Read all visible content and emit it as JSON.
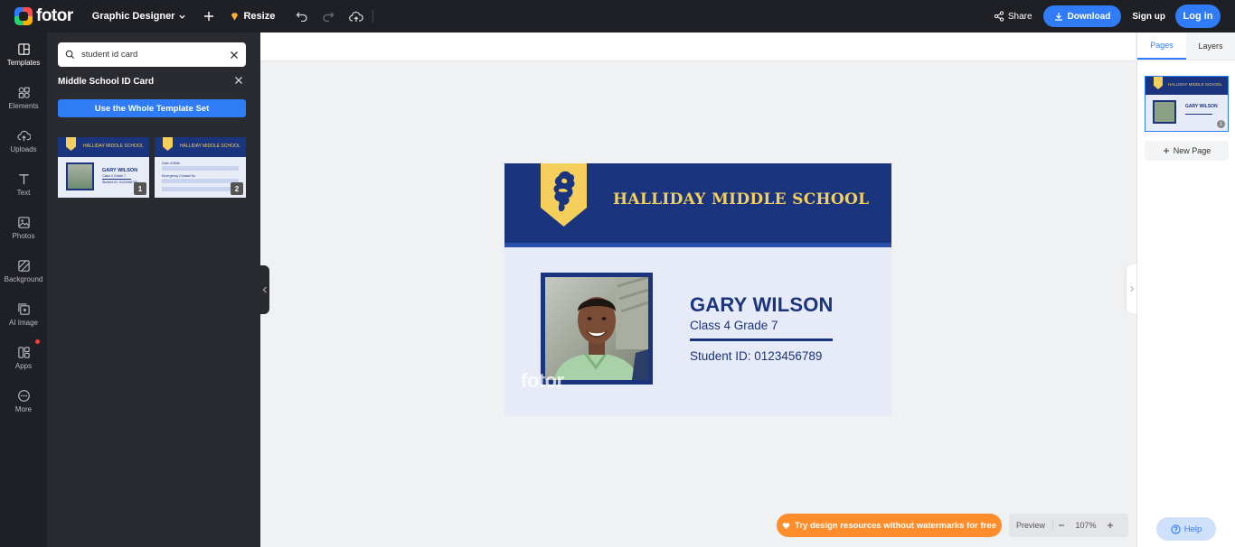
{
  "header": {
    "brand": "fotor",
    "design_type": "Graphic Designer",
    "resize_label": "Resize",
    "share_label": "Share",
    "download_label": "Download",
    "signup_label": "Sign up",
    "login_label": "Log in"
  },
  "sidebar": {
    "items": [
      {
        "label": "Templates",
        "icon": "templates-icon"
      },
      {
        "label": "Elements",
        "icon": "elements-icon"
      },
      {
        "label": "Uploads",
        "icon": "upload-cloud-icon"
      },
      {
        "label": "Text",
        "icon": "text-icon"
      },
      {
        "label": "Photos",
        "icon": "photo-icon"
      },
      {
        "label": "Background",
        "icon": "background-icon"
      },
      {
        "label": "AI Image",
        "icon": "ai-image-icon"
      },
      {
        "label": "Apps",
        "icon": "apps-icon"
      },
      {
        "label": "More",
        "icon": "more-icon"
      }
    ]
  },
  "panel": {
    "search_value": "student id card",
    "title": "Middle School ID Card",
    "use_button": "Use the Whole Template Set",
    "thumbs": [
      {
        "number": "1",
        "school": "HALLIDAY MIDDLE SCHOOL",
        "name": "GARY WILSON",
        "line": "Class 4 Grade 7",
        "sid": "Student ID: 0123456789"
      },
      {
        "number": "2",
        "school": "HALLIDAY MIDDLE SCHOOL",
        "field1": "Date of Birth",
        "field2": "Emergency Contact No."
      }
    ]
  },
  "card": {
    "school": "HALLIDAY MIDDLE SCHOOL",
    "name": "GARY WILSON",
    "class_line": "Class 4 Grade 7",
    "student_id": "Student ID: 0123456789",
    "watermark": "fotor",
    "colors": {
      "navy": "#1a347e",
      "gold": "#f5cf5c",
      "light": "#e6ebf7"
    }
  },
  "bottom": {
    "promo": "Try design resources without watermarks for free",
    "preview": "Preview",
    "zoom": "107%"
  },
  "right_panel": {
    "tab_pages": "Pages",
    "tab_layers": "Layers",
    "page_number": "1",
    "thumb_school": "HALLIDAY MIDDLE SCHOOL",
    "thumb_name": "GARY WILSON",
    "new_page": "New Page",
    "help": "Help"
  }
}
